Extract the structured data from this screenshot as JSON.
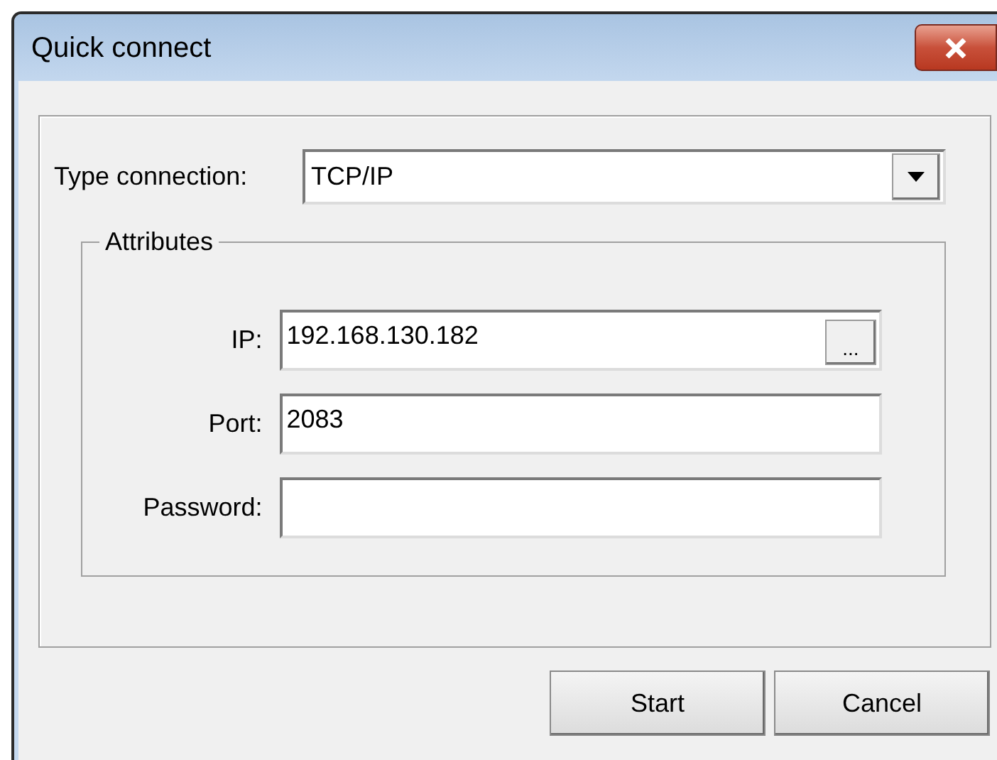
{
  "window": {
    "title": "Quick connect"
  },
  "type_connection": {
    "label": "Type connection:",
    "value": "TCP/IP"
  },
  "attributes": {
    "legend": "Attributes",
    "fields": [
      {
        "label": "IP:",
        "value": "192.168.130.182",
        "kind": "browse",
        "browse_button": "..."
      },
      {
        "label": "Port:",
        "value": "2083",
        "kind": "text"
      },
      {
        "label": "Password:",
        "kind": "text"
      }
    ]
  },
  "buttons": [
    "Start",
    "Cancel"
  ]
}
